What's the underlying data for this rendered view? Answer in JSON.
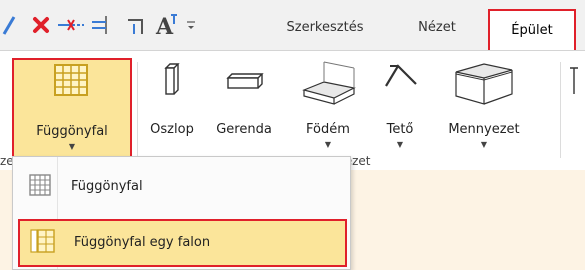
{
  "tabs": {
    "tab1": "Szerkesztés",
    "tab2": "Nézet",
    "tab3": "Épület"
  },
  "tools": {
    "curtain": "Függönyfal",
    "column": "Oszlop",
    "beam": "Gerenda",
    "slab": "Födém",
    "roof": "Tető",
    "ceiling": "Mennyezet"
  },
  "group_label": "tezet",
  "group_label_left": "ze",
  "menu": {
    "item1": "Függönyfal",
    "item2": "Függönyfal egy falon"
  },
  "colors": {
    "accent": "#e0202a",
    "highlight": "#fbe59a",
    "icon": "#c8a020"
  }
}
